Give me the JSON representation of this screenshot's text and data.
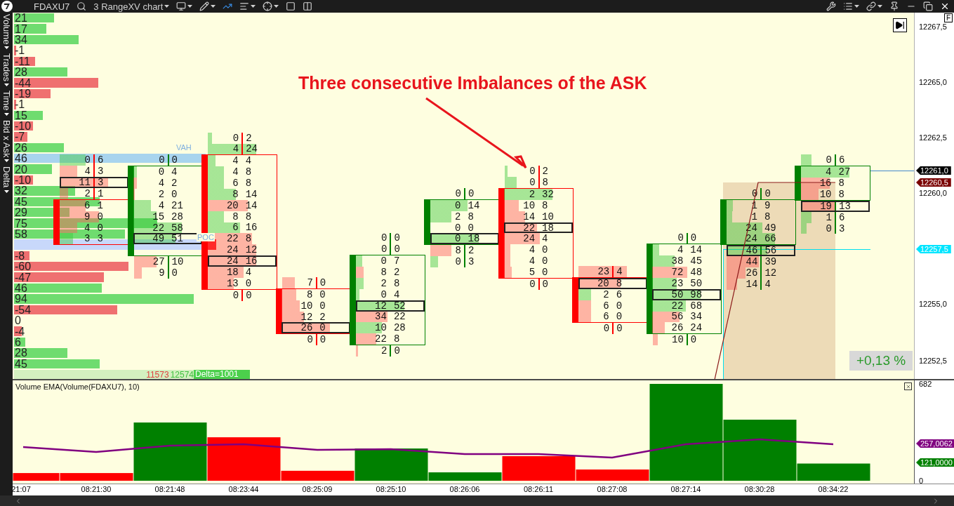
{
  "toolbar": {
    "instrument": "FDAXU7",
    "chart_type": "3 RangeXV chart"
  },
  "sidebar": {
    "items": [
      {
        "label": "Volume"
      },
      {
        "label": "Trades"
      },
      {
        "label": "Time"
      },
      {
        "label": "Bid x Ask"
      },
      {
        "label": "Delta"
      }
    ]
  },
  "profile": {
    "rows": [
      {
        "kind": "value",
        "value": "21",
        "highlighted": false
      },
      {
        "kind": "value",
        "value": "17",
        "highlighted": false
      },
      {
        "kind": "value",
        "value": "34",
        "highlighted": false
      },
      {
        "kind": "value",
        "value": "-1",
        "highlighted": false
      },
      {
        "kind": "value",
        "value": "-11",
        "highlighted": false
      },
      {
        "kind": "value",
        "value": "28",
        "highlighted": false
      },
      {
        "kind": "value",
        "value": "-44",
        "highlighted": false
      },
      {
        "kind": "value",
        "value": "-19",
        "highlighted": false
      },
      {
        "kind": "value",
        "value": "-1",
        "highlighted": false
      },
      {
        "kind": "value",
        "value": "15",
        "highlighted": false
      },
      {
        "kind": "value",
        "value": "-10",
        "highlighted": false
      },
      {
        "kind": "value",
        "value": "-7",
        "highlighted": false
      },
      {
        "kind": "value",
        "value": "26",
        "highlighted": false
      },
      {
        "kind": "value",
        "value": "46",
        "highlighted": true
      },
      {
        "kind": "value",
        "value": "20",
        "highlighted": false
      },
      {
        "kind": "value",
        "value": "-10",
        "highlighted": false
      },
      {
        "kind": "value",
        "value": "32",
        "highlighted": false
      },
      {
        "kind": "value",
        "value": "45",
        "highlighted": false
      },
      {
        "kind": "value",
        "value": "29",
        "highlighted": false
      },
      {
        "kind": "value",
        "value": "75",
        "highlighted": false
      },
      {
        "kind": "value",
        "value": "58",
        "highlighted": false
      },
      {
        "kind": "band"
      },
      {
        "kind": "value",
        "value": "-8",
        "highlighted": false
      },
      {
        "kind": "value",
        "value": "-60",
        "highlighted": false
      },
      {
        "kind": "value",
        "value": "-47",
        "highlighted": false
      },
      {
        "kind": "value",
        "value": "46",
        "highlighted": false
      },
      {
        "kind": "value",
        "value": "94",
        "highlighted": false
      },
      {
        "kind": "value",
        "value": "-54",
        "highlighted": false
      },
      {
        "kind": "value",
        "value": "0",
        "highlighted": false
      },
      {
        "kind": "value",
        "value": "-4",
        "highlighted": false
      },
      {
        "kind": "value",
        "value": "6",
        "highlighted": false
      },
      {
        "kind": "value",
        "value": "28",
        "highlighted": false
      },
      {
        "kind": "value",
        "value": "45",
        "highlighted": false
      }
    ],
    "footer": {
      "bid_total": "11573",
      "ask_total": "12574",
      "delta": "Delta=1001"
    }
  },
  "labels": {
    "vah": "VAH",
    "poc": "POC"
  },
  "clusters": [
    {
      "color": "#ff0000",
      "upper_wick": [
        {
          "bid": "0",
          "ask": "6",
          "poc": false
        },
        {
          "bid": "4",
          "ask": "3",
          "poc": false
        },
        {
          "bid": "11",
          "ask": "3",
          "poc": true
        },
        {
          "bid": "2",
          "ask": "1",
          "poc": false
        }
      ],
      "body": [
        {
          "bid": "6",
          "ask": "1",
          "poc": false
        },
        {
          "bid": "9",
          "ask": "0",
          "poc": false
        },
        {
          "bid": "4",
          "ask": "0",
          "poc": false
        },
        {
          "bid": "3",
          "ask": "3",
          "poc": false
        }
      ]
    },
    {
      "color": "#008000",
      "upper_wick": [
        {
          "bid": "0",
          "ask": "0",
          "poc": false
        }
      ],
      "body": [
        {
          "bid": "0",
          "ask": "4",
          "poc": false
        },
        {
          "bid": "4",
          "ask": "2",
          "poc": false
        },
        {
          "bid": "2",
          "ask": "0",
          "poc": false
        },
        {
          "bid": "4",
          "ask": "21",
          "poc": false
        },
        {
          "bid": "15",
          "ask": "28",
          "poc": false
        },
        {
          "bid": "22",
          "ask": "58",
          "poc": false
        },
        {
          "bid": "49",
          "ask": "51",
          "poc": true
        }
      ],
      "lower_wick": [
        {
          "bid": "27",
          "ask": "10",
          "poc": false
        },
        {
          "bid": "9",
          "ask": "0",
          "poc": false
        }
      ]
    },
    {
      "color": "#ff0000",
      "upper_wick": [
        {
          "bid": "0",
          "ask": "2",
          "poc": false
        },
        {
          "bid": "4",
          "ask": "24",
          "poc": false
        }
      ],
      "body": [
        {
          "bid": "4",
          "ask": "4",
          "poc": false
        },
        {
          "bid": "4",
          "ask": "8",
          "poc": false
        },
        {
          "bid": "6",
          "ask": "8",
          "poc": false
        },
        {
          "bid": "8",
          "ask": "14",
          "poc": false
        },
        {
          "bid": "20",
          "ask": "14",
          "poc": false
        },
        {
          "bid": "8",
          "ask": "8",
          "poc": false
        },
        {
          "bid": "6",
          "ask": "16",
          "poc": false
        },
        {
          "bid": "22",
          "ask": "8",
          "poc": false
        },
        {
          "bid": "24",
          "ask": "12",
          "poc": false
        },
        {
          "bid": "24",
          "ask": "16",
          "poc": true
        },
        {
          "bid": "18",
          "ask": "4",
          "poc": false
        },
        {
          "bid": "13",
          "ask": "0",
          "poc": false
        }
      ],
      "lower_wick": [
        {
          "bid": "0",
          "ask": "0",
          "poc": false
        }
      ]
    },
    {
      "color": "#ff0000",
      "upper_wick": [
        {
          "bid": "7",
          "ask": "0",
          "poc": false
        }
      ],
      "body": [
        {
          "bid": "8",
          "ask": "0",
          "poc": false
        },
        {
          "bid": "10",
          "ask": "0",
          "poc": false
        },
        {
          "bid": "12",
          "ask": "2",
          "poc": false
        },
        {
          "bid": "26",
          "ask": "0",
          "poc": true
        }
      ],
      "lower_wick": [
        {
          "bid": "0",
          "ask": "0",
          "poc": false
        }
      ]
    },
    {
      "color": "#008000",
      "upper_wick": [
        {
          "bid": "0",
          "ask": "0",
          "poc": false
        },
        {
          "bid": "0",
          "ask": "0",
          "poc": false
        }
      ],
      "body": [
        {
          "bid": "0",
          "ask": "7",
          "poc": false
        },
        {
          "bid": "8",
          "ask": "2",
          "poc": false
        },
        {
          "bid": "2",
          "ask": "8",
          "poc": false
        },
        {
          "bid": "0",
          "ask": "4",
          "poc": false
        },
        {
          "bid": "12",
          "ask": "52",
          "poc": true
        },
        {
          "bid": "34",
          "ask": "22",
          "poc": false
        },
        {
          "bid": "10",
          "ask": "28",
          "poc": false
        },
        {
          "bid": "22",
          "ask": "8",
          "poc": false
        }
      ],
      "lower_wick": [
        {
          "bid": "2",
          "ask": "0",
          "poc": false
        }
      ]
    },
    {
      "color": "#008000",
      "upper_wick": [
        {
          "bid": "0",
          "ask": "0",
          "poc": false
        }
      ],
      "body": [
        {
          "bid": "0",
          "ask": "14",
          "poc": false
        },
        {
          "bid": "2",
          "ask": "8",
          "poc": false
        },
        {
          "bid": "0",
          "ask": "0",
          "poc": false
        },
        {
          "bid": "0",
          "ask": "18",
          "poc": true
        }
      ],
      "lower_wick": [
        {
          "bid": "8",
          "ask": "2",
          "poc": false
        },
        {
          "bid": "0",
          "ask": "3",
          "poc": false
        }
      ]
    },
    {
      "color": "#ff0000",
      "upper_wick": [
        {
          "bid": "0",
          "ask": "2",
          "poc": false
        },
        {
          "bid": "0",
          "ask": "8",
          "poc": false
        }
      ],
      "body": [
        {
          "bid": "2",
          "ask": "32",
          "poc": false
        },
        {
          "bid": "10",
          "ask": "8",
          "poc": false
        },
        {
          "bid": "14",
          "ask": "10",
          "poc": false
        },
        {
          "bid": "22",
          "ask": "18",
          "poc": true
        },
        {
          "bid": "24",
          "ask": "4",
          "poc": false
        },
        {
          "bid": "4",
          "ask": "0",
          "poc": false
        },
        {
          "bid": "4",
          "ask": "0",
          "poc": false
        },
        {
          "bid": "5",
          "ask": "0",
          "poc": false
        }
      ],
      "lower_wick": [
        {
          "bid": "0",
          "ask": "0",
          "poc": false
        }
      ]
    },
    {
      "color": "#ff0000",
      "upper_wick": [
        {
          "bid": "23",
          "ask": "4",
          "poc": false
        }
      ],
      "body": [
        {
          "bid": "20",
          "ask": "8",
          "poc": true
        },
        {
          "bid": "2",
          "ask": "6",
          "poc": false
        },
        {
          "bid": "6",
          "ask": "0",
          "poc": false
        },
        {
          "bid": "6",
          "ask": "0",
          "poc": false
        }
      ],
      "lower_wick": [
        {
          "bid": "0",
          "ask": "0",
          "poc": false
        }
      ]
    },
    {
      "color": "#008000",
      "upper_wick": [
        {
          "bid": "0",
          "ask": "0",
          "poc": false
        }
      ],
      "body": [
        {
          "bid": "4",
          "ask": "14",
          "poc": false
        },
        {
          "bid": "38",
          "ask": "45",
          "poc": false
        },
        {
          "bid": "72",
          "ask": "48",
          "poc": false
        },
        {
          "bid": "23",
          "ask": "50",
          "poc": false
        },
        {
          "bid": "50",
          "ask": "98",
          "poc": true
        },
        {
          "bid": "22",
          "ask": "68",
          "poc": false
        },
        {
          "bid": "56",
          "ask": "34",
          "poc": false
        },
        {
          "bid": "26",
          "ask": "24",
          "poc": false
        }
      ],
      "lower_wick": [
        {
          "bid": "10",
          "ask": "0",
          "poc": false
        }
      ]
    },
    {
      "color": "#008000",
      "upper_wick": [
        {
          "bid": "0",
          "ask": "0",
          "poc": false
        }
      ],
      "body": [
        {
          "bid": "1",
          "ask": "9",
          "poc": false
        },
        {
          "bid": "1",
          "ask": "8",
          "poc": false
        },
        {
          "bid": "24",
          "ask": "49",
          "poc": false
        },
        {
          "bid": "24",
          "ask": "66",
          "poc": false
        }
      ],
      "lower_wick": [
        {
          "bid": "46",
          "ask": "56",
          "poc": true
        },
        {
          "bid": "44",
          "ask": "39",
          "poc": false
        },
        {
          "bid": "26",
          "ask": "12",
          "poc": false
        },
        {
          "bid": "14",
          "ask": "4",
          "poc": false
        }
      ]
    },
    {
      "color": "#008000",
      "upper_wick": [
        {
          "bid": "0",
          "ask": "6",
          "poc": false
        }
      ],
      "body": [
        {
          "bid": "4",
          "ask": "27",
          "poc": false
        },
        {
          "bid": "16",
          "ask": "8",
          "poc": false
        },
        {
          "bid": "10",
          "ask": "8",
          "poc": false
        }
      ],
      "lower_wick": [
        {
          "bid": "19",
          "ask": "13",
          "poc": true
        },
        {
          "bid": "1",
          "ask": "6",
          "poc": false
        },
        {
          "bid": "0",
          "ask": "3",
          "poc": false
        }
      ]
    }
  ],
  "annotation": {
    "text": "Three consecutive Imbalances of the ASK"
  },
  "change_badge": "+0,13 %",
  "price_axis": {
    "mode_badge": "F",
    "ticks": [
      "12267,5",
      "12265,0",
      "12262,5",
      "12260,0",
      "12255,0",
      "12252,5"
    ],
    "tags": [
      {
        "text": "12261,0",
        "color": "#000000"
      },
      {
        "text": "12260,5",
        "color": "#7a0000"
      },
      {
        "text": "12257,5",
        "color": "#00e5ff"
      }
    ]
  },
  "volume_panel": {
    "title": "Volume EMA(Volume(FDAXU7), 10)",
    "chart_data": {
      "type": "bar",
      "categories": [
        "21:07",
        "08:21:30",
        "08:21:48",
        "08:23:44",
        "08:25:09",
        "08:25:10",
        "08:26:06",
        "08:26:11",
        "08:27:08",
        "08:27:14",
        "08:30:28",
        "08:34:22"
      ],
      "ylim": [
        0,
        682
      ],
      "yticks": [
        0,
        682
      ],
      "series": [
        {
          "color": "#008000",
          "values": [
            null,
            null,
            410,
            null,
            null,
            227,
            59,
            null,
            null,
            682,
            430,
            121
          ]
        },
        {
          "color": "#ff0000",
          "values": [
            54,
            54,
            null,
            306,
            70,
            null,
            null,
            173,
            79,
            null,
            null,
            null
          ]
        }
      ]
    },
    "ema": {
      "chart_data": {
        "type": "line",
        "ylim": [
          0,
          682
        ],
        "series": [
          {
            "color": "#800080",
            "values": [
              237,
              203,
              247,
              257,
              217,
              222,
              188,
              188,
              163,
              257,
              291,
              257
            ]
          }
        ]
      }
    },
    "value_tags": [
      {
        "text": "257,0062",
        "color": "#800080"
      },
      {
        "text": "121,0000",
        "color": "#008000"
      }
    ]
  }
}
